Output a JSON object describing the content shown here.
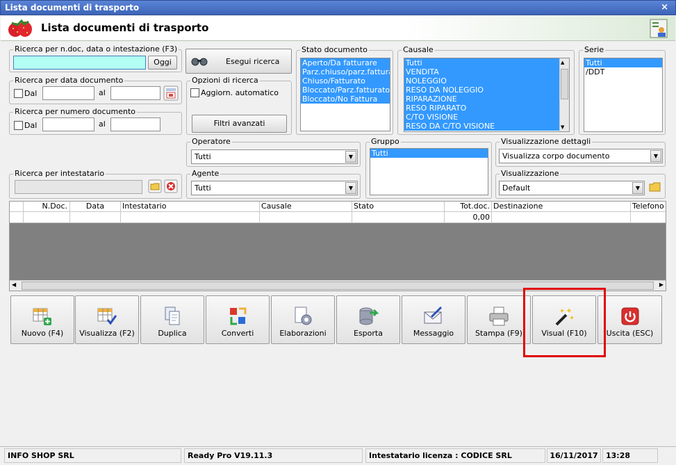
{
  "window": {
    "title": "Lista documenti di trasporto",
    "close_glyph": "×"
  },
  "header": {
    "title": "Lista documenti di trasporto",
    "logo_icon": "strawberry-icon",
    "profile_icon": "user-card-icon"
  },
  "search_text": {
    "label": "Ricerca per n.doc, data o intestazione (F3)",
    "value": "",
    "today_button": "Oggi"
  },
  "search_date": {
    "label": "Ricerca per data documento",
    "from_label": "Dal",
    "to_label": "al",
    "from_value": "",
    "to_value": ""
  },
  "search_number": {
    "label": "Ricerca per numero documento",
    "from_label": "Dal",
    "to_label": "al",
    "from_value": "",
    "to_value": ""
  },
  "search_holder": {
    "label": "Ricerca per intestatario",
    "value": ""
  },
  "search_button": {
    "label": "Esegui ricerca"
  },
  "search_options": {
    "label": "Opzioni di ricerca",
    "auto_update_label": "Aggiorn. automatico"
  },
  "advanced_filters": {
    "label": "Filtri avanzati"
  },
  "stato_documento": {
    "label": "Stato documento",
    "items": [
      "Aperto/Da fatturare",
      "Parz.chiuso/parz.fatturato",
      "Chiuso/Fatturato",
      "Bloccato/Parz.fatturato",
      "Bloccato/No Fattura"
    ]
  },
  "causale": {
    "label": "Causale",
    "items": [
      "Tutti",
      "VENDITA",
      "NOLEGGIO",
      "RESO DA NOLEGGIO",
      "RIPARAZIONE",
      "RESO RIPARATO",
      "C/TO VISIONE",
      "RESO DA C/TO VISIONE"
    ]
  },
  "serie": {
    "label": "Serie",
    "items": [
      "Tutti",
      "/DDT"
    ]
  },
  "operatore": {
    "label": "Operatore",
    "value": "Tutti"
  },
  "agente": {
    "label": "Agente",
    "value": "Tutti"
  },
  "gruppo": {
    "label": "Gruppo",
    "items": [
      "Tutti"
    ]
  },
  "vis_dettagli": {
    "label": "Visualizzazione dettagli",
    "value": "Visualizza corpo documento"
  },
  "visualizzazione": {
    "label": "Visualizzazione",
    "value": "Default"
  },
  "grid": {
    "columns": [
      "N.Doc.",
      "Data",
      "Intestatario",
      "Causale",
      "Stato",
      "Tot.doc.",
      "Destinazione",
      "Telefono"
    ],
    "total_row": {
      "totdoc": "0,00"
    }
  },
  "toolbar": {
    "nuovo": "Nuovo (F4)",
    "visualizza": "Visualizza (F2)",
    "duplica": "Duplica",
    "converti": "Converti",
    "elaborazioni": "Elaborazioni",
    "esporta": "Esporta",
    "messaggio": "Messaggio",
    "stampa": "Stampa (F9)",
    "visual": "Visual (F10)",
    "uscita": "Uscita (ESC)"
  },
  "highlight_color": "#e00000",
  "status": {
    "company": "INFO SHOP SRL",
    "version": "Ready Pro V19.11.3",
    "license": "Intestatario licenza : CODICE SRL",
    "date": "16/11/2017",
    "time": "13:28"
  }
}
